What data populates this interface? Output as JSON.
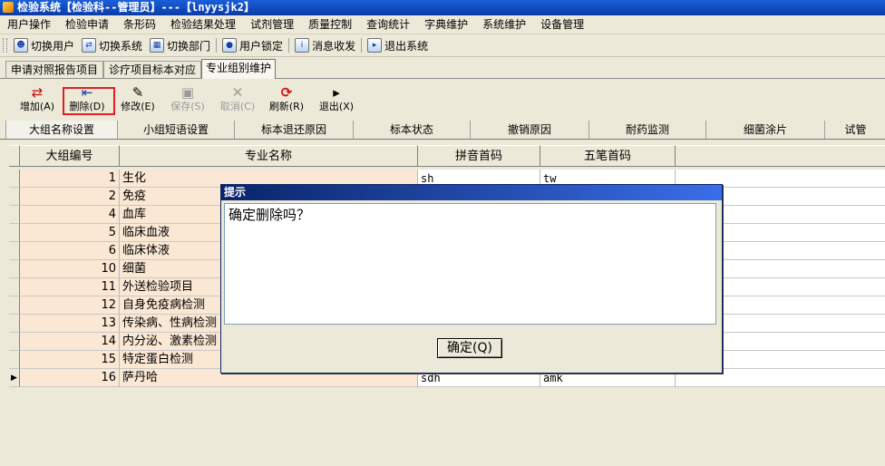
{
  "window": {
    "title": "检验系统【检验科--管理员】---【lnyysjk2】"
  },
  "menu": [
    "用户操作",
    "检验申请",
    "条形码",
    "检验结果处理",
    "试剂管理",
    "质量控制",
    "查询统计",
    "字典维护",
    "系统维护",
    "设备管理"
  ],
  "quickbar": [
    {
      "label": "切换用户",
      "icon": "users-icon"
    },
    {
      "label": "切换系统",
      "icon": "system-switch-icon"
    },
    {
      "label": "切换部门",
      "icon": "department-icon"
    },
    {
      "label": "用户锁定",
      "icon": "user-lock-icon"
    },
    {
      "label": "消息收发",
      "icon": "message-icon"
    },
    {
      "label": "退出系统",
      "icon": "exit-icon"
    }
  ],
  "page_tabs": [
    "申请对照报告项目",
    "诊疗项目标本对应",
    "专业组别维护"
  ],
  "toolbar": [
    {
      "label": "增加(A)",
      "icon": "add-icon",
      "enabled": true
    },
    {
      "label": "删除(D)",
      "icon": "delete-icon",
      "enabled": true
    },
    {
      "label": "修改(E)",
      "icon": "edit-icon",
      "enabled": true
    },
    {
      "label": "保存(S)",
      "icon": "save-icon",
      "enabled": false
    },
    {
      "label": "取消(C)",
      "icon": "cancel-icon",
      "enabled": false
    },
    {
      "label": "刷新(R)",
      "icon": "refresh-icon",
      "enabled": true
    },
    {
      "label": "退出(X)",
      "icon": "exit-icon",
      "enabled": true
    }
  ],
  "sub_tabs": [
    "大组名称设置",
    "小组短语设置",
    "标本退还原因",
    "标本状态",
    "撤销原因",
    "耐药监测",
    "细菌涂片",
    "试管"
  ],
  "grid": {
    "headers": [
      "大组编号",
      "专业名称",
      "拼音首码",
      "五笔首码"
    ],
    "rows": [
      {
        "id": "1",
        "name": "生化",
        "py": "sh",
        "wb": "tw"
      },
      {
        "id": "2",
        "name": "免疫",
        "py": "",
        "wb": ""
      },
      {
        "id": "4",
        "name": "血库",
        "py": "",
        "wb": ""
      },
      {
        "id": "5",
        "name": "临床血液",
        "py": "",
        "wb": ""
      },
      {
        "id": "6",
        "name": "临床体液",
        "py": "",
        "wb": ""
      },
      {
        "id": "10",
        "name": "细菌",
        "py": "",
        "wb": ""
      },
      {
        "id": "11",
        "name": "外送检验项目",
        "py": "",
        "wb": ""
      },
      {
        "id": "12",
        "name": "自身免疫病检测",
        "py": "",
        "wb": ""
      },
      {
        "id": "13",
        "name": "传染病、性病检测",
        "py": "",
        "wb": ""
      },
      {
        "id": "14",
        "name": "内分泌、激素检测",
        "py": "",
        "wb": ""
      },
      {
        "id": "15",
        "name": "特定蛋白检测",
        "py": "",
        "wb": ""
      },
      {
        "id": "16",
        "name": "萨丹哈",
        "py": "sdh",
        "wb": "amk"
      }
    ]
  },
  "dialog": {
    "title": "提示",
    "message": "确定删除吗？",
    "ok_label": "确定(Q)"
  }
}
